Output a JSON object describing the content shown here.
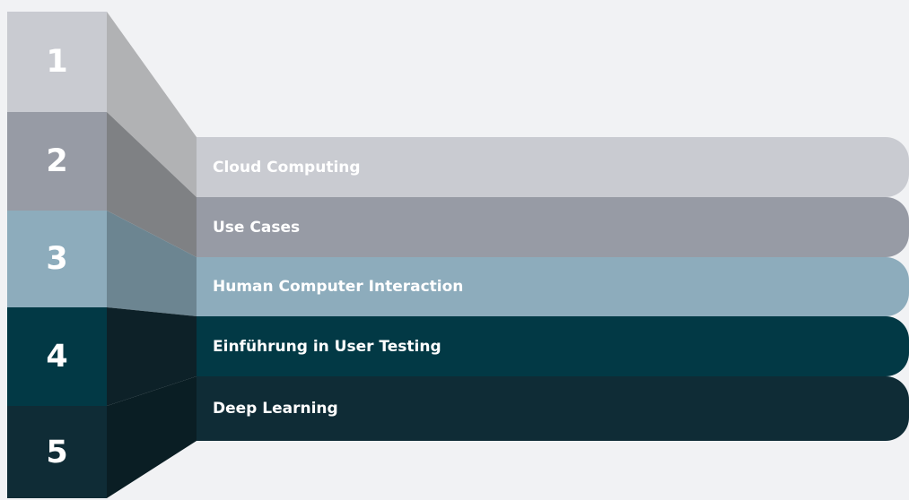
{
  "steps": [
    {
      "number": "1",
      "label": "Cloud Computing",
      "color": "#c9cbd1",
      "shade": "#b1b2b4"
    },
    {
      "number": "2",
      "label": "Use Cases",
      "color": "#979ba5",
      "shade": "#7f8184"
    },
    {
      "number": "3",
      "label": "Human Computer Interaction",
      "color": "#8dacbc",
      "shade": "#6c8591"
    },
    {
      "number": "4",
      "label": "Einführung in User Testing",
      "color": "#023945",
      "shade": "#0d2128"
    },
    {
      "number": "5",
      "label": "Deep Learning",
      "color": "#0f2c36",
      "shade": "#0a1e24"
    }
  ]
}
